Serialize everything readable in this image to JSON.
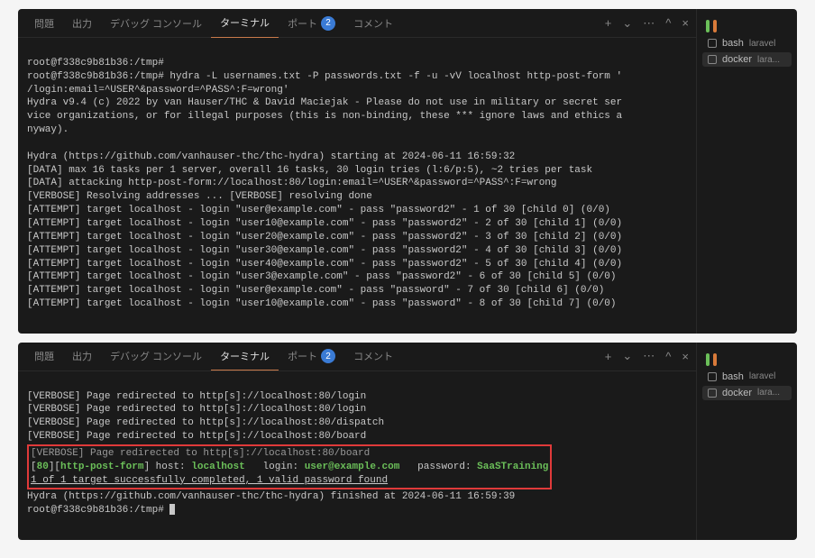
{
  "tabs": {
    "problems": "問題",
    "output": "出力",
    "debugConsole": "デバッグ コンソール",
    "terminal": "ターミナル",
    "ports": "ポート",
    "portsBadge": "2",
    "comments": "コメント"
  },
  "sidebar": {
    "items": [
      {
        "icon": "terminal-icon",
        "name": "bash",
        "sub": "laravel"
      },
      {
        "icon": "terminal-icon",
        "name": "docker",
        "sub": "lara..."
      }
    ]
  },
  "term1": {
    "lines": [
      "root@f338c9b81b36:/tmp#",
      "root@f338c9b81b36:/tmp# hydra -L usernames.txt -P passwords.txt -f -u -vV localhost http-post-form '",
      "/login:email=^USER^&password=^PASS^:F=wrong'",
      "Hydra v9.4 (c) 2022 by van Hauser/THC & David Maciejak - Please do not use in military or secret ser",
      "vice organizations, or for illegal purposes (this is non-binding, these *** ignore laws and ethics a",
      "nyway).",
      "",
      "Hydra (https://github.com/vanhauser-thc/thc-hydra) starting at 2024-06-11 16:59:32",
      "[DATA] max 16 tasks per 1 server, overall 16 tasks, 30 login tries (l:6/p:5), ~2 tries per task",
      "[DATA] attacking http-post-form://localhost:80/login:email=^USER^&password=^PASS^:F=wrong",
      "[VERBOSE] Resolving addresses ... [VERBOSE] resolving done",
      "[ATTEMPT] target localhost - login \"user@example.com\" - pass \"password2\" - 1 of 30 [child 0] (0/0)",
      "[ATTEMPT] target localhost - login \"user10@example.com\" - pass \"password2\" - 2 of 30 [child 1] (0/0)",
      "[ATTEMPT] target localhost - login \"user20@example.com\" - pass \"password2\" - 3 of 30 [child 2] (0/0)",
      "[ATTEMPT] target localhost - login \"user30@example.com\" - pass \"password2\" - 4 of 30 [child 3] (0/0)",
      "[ATTEMPT] target localhost - login \"user40@example.com\" - pass \"password2\" - 5 of 30 [child 4] (0/0)",
      "[ATTEMPT] target localhost - login \"user3@example.com\" - pass \"password2\" - 6 of 30 [child 5] (0/0)",
      "[ATTEMPT] target localhost - login \"user@example.com\" - pass \"password\" - 7 of 30 [child 6] (0/0)",
      "[ATTEMPT] target localhost - login \"user10@example.com\" - pass \"password\" - 8 of 30 [child 7] (0/0)"
    ]
  },
  "term2": {
    "pre": [
      "[VERBOSE] Page redirected to http[s]://localhost:80/login",
      "[VERBOSE] Page redirected to http[s]://localhost:80/login",
      "[VERBOSE] Page redirected to http[s]://localhost:80/dispatch",
      "[VERBOSE] Page redirected to http[s]://localhost:80/board"
    ],
    "struck": "[VERBOSE] Page redirected to http[s]://localhost:80/board",
    "result": {
      "port": "80",
      "service": "http-post-form",
      "hostLabel": " host: ",
      "host": "localhost",
      "loginLabel": "   login: ",
      "login": "user@example.com",
      "passwordLabel": "   password: ",
      "password": "SaaSTraining"
    },
    "summary": "1 of 1 target successfully completed, 1 valid password found",
    "finished": "Hydra (https://github.com/vanhauser-thc/thc-hydra) finished at 2024-06-11 16:59:39",
    "prompt": "root@f338c9b81b36:/tmp# "
  }
}
